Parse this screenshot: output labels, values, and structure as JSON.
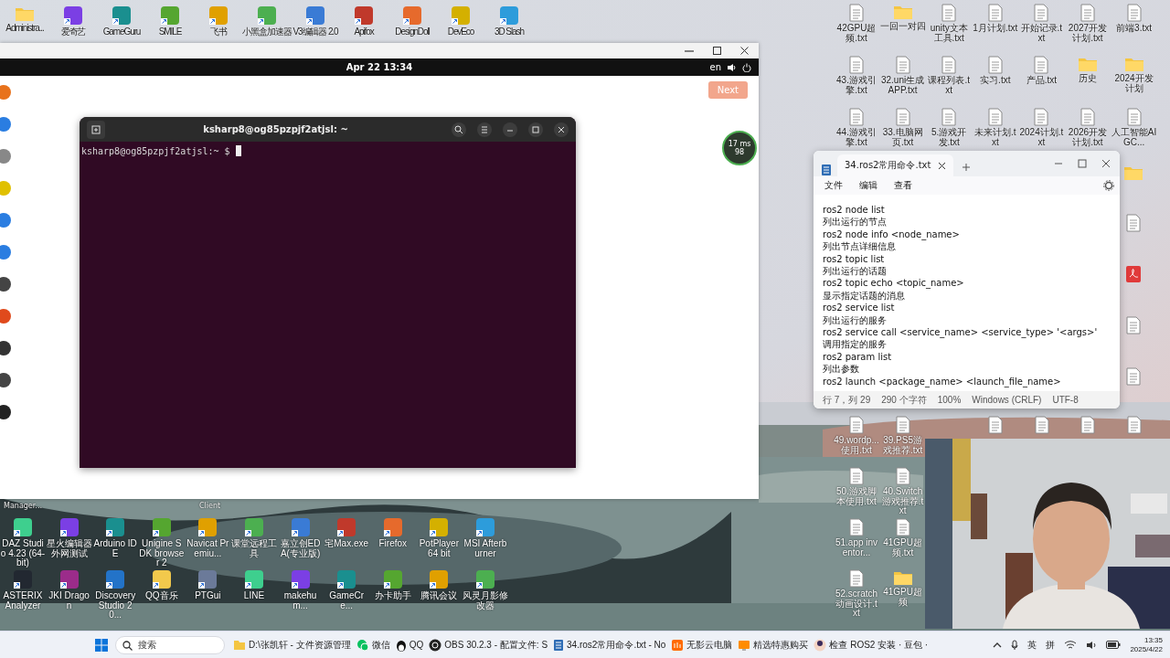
{
  "desktop_top_icons": [
    {
      "label": "Administra...",
      "kind": "folder"
    },
    {
      "label": "爱奇艺",
      "kind": "app"
    },
    {
      "label": "GameGuru",
      "kind": "app"
    },
    {
      "label": "SMILE",
      "kind": "app"
    },
    {
      "label": "飞书",
      "kind": "app"
    },
    {
      "label": "小黑盒加速器",
      "kind": "app"
    },
    {
      "label": "V3编辑器 2.0",
      "kind": "app"
    },
    {
      "label": "Apifox",
      "kind": "app"
    },
    {
      "label": "DesignDoll",
      "kind": "app"
    },
    {
      "label": "DevEco",
      "kind": "app"
    },
    {
      "label": "3D Slash",
      "kind": "app"
    }
  ],
  "remote_window": {
    "topbar": {
      "clock": "Apr 22 13:34",
      "language": "en"
    },
    "page": {
      "next_button": "Next",
      "ping_latency": "17 ms",
      "ping_value": "98"
    },
    "terminal": {
      "title": "ksharp8@og85pzpjf2atjsl: ~",
      "prompt_user": "ksharp8@og85pzpjf2atjsl",
      "prompt_path": ":~",
      "prompt_symbol": "$"
    }
  },
  "desktop_captions": [
    "Manager...",
    "Client"
  ],
  "desktop_bottom_icons": [
    {
      "label": "DAZ Studio 4.23 (64-bit)",
      "kind": "app"
    },
    {
      "label": "星火编辑器外网测试",
      "kind": "app"
    },
    {
      "label": "Arduino IDE",
      "kind": "app"
    },
    {
      "label": "Unigine SDK browser 2",
      "kind": "app"
    },
    {
      "label": "Navicat Premiu...",
      "kind": "app"
    },
    {
      "label": "课堂远程工具",
      "kind": "app"
    },
    {
      "label": "嘉立创EDA(专业版)",
      "kind": "app"
    },
    {
      "label": "宅Max.exe",
      "kind": "app"
    },
    {
      "label": "Firefox",
      "kind": "app"
    },
    {
      "label": "PotPlayer 64 bit",
      "kind": "app"
    },
    {
      "label": "MSI Afterburner",
      "kind": "app"
    },
    {
      "label": "ASTERIX Analyzer",
      "kind": "app"
    },
    {
      "label": "JKI Dragon",
      "kind": "app"
    },
    {
      "label": "Discovery Studio 20...",
      "kind": "app"
    },
    {
      "label": "QQ音乐",
      "kind": "app"
    },
    {
      "label": "PTGui",
      "kind": "app"
    },
    {
      "label": "LINE",
      "kind": "app"
    },
    {
      "label": "makehum...",
      "kind": "app"
    },
    {
      "label": "GameCre...",
      "kind": "app"
    },
    {
      "label": "办卡助手",
      "kind": "app"
    },
    {
      "label": "腾讯会议",
      "kind": "app"
    },
    {
      "label": "风灵月影修改器",
      "kind": "app"
    }
  ],
  "desktop_right_icons": [
    {
      "label": "42GPU超频.txt",
      "kind": "file"
    },
    {
      "label": "一回一对四",
      "kind": "folder"
    },
    {
      "label": "unity文本工具.txt",
      "kind": "file"
    },
    {
      "label": "1月计划.txt",
      "kind": "file"
    },
    {
      "label": "开始记录.txt",
      "kind": "file"
    },
    {
      "label": "2027开发计划.txt",
      "kind": "file"
    },
    {
      "label": "前端3.txt",
      "kind": "file"
    },
    {
      "label": "43.游戏引擎.txt",
      "kind": "file"
    },
    {
      "label": "32.uni生成APP.txt",
      "kind": "file"
    },
    {
      "label": "课程列表.txt",
      "kind": "file"
    },
    {
      "label": "实习.txt",
      "kind": "file"
    },
    {
      "label": "产品.txt",
      "kind": "file"
    },
    {
      "label": "历史",
      "kind": "folder"
    },
    {
      "label": "2024开发计划",
      "kind": "folder"
    },
    {
      "label": "44.游戏引擎.txt",
      "kind": "file"
    },
    {
      "label": "33.电脑网页.txt",
      "kind": "file"
    },
    {
      "label": "5.游戏开发.txt",
      "kind": "file"
    },
    {
      "label": "未来计划.txt",
      "kind": "file"
    },
    {
      "label": "2024计划.txt",
      "kind": "file"
    },
    {
      "label": "2026开发计划.txt",
      "kind": "file"
    },
    {
      "label": "人工智能AIGC...",
      "kind": "file"
    }
  ],
  "desktop_side_icons": [
    {
      "kind": "folder"
    },
    {
      "kind": "file"
    },
    {
      "kind": "pdf"
    },
    {
      "kind": "file"
    },
    {
      "kind": "file"
    }
  ],
  "notepad": {
    "tab": "34.ros2常用命令.txt",
    "menu": [
      "文件",
      "编辑",
      "查看"
    ],
    "lines": [
      "ros2 node list",
      "列出运行的节点",
      "ros2 node info <node_name>",
      "列出节点详细信息",
      "ros2 topic list",
      "列出运行的话题",
      "ros2 topic echo <topic_name>",
      "显示指定话题的消息",
      "ros2 service list",
      "列出运行的服务",
      "ros2 service call <service_name> <service_type> '<args>'",
      "调用指定的服务",
      "ros2 param list",
      "列出参数",
      "ros2 launch <package_name> <launch_file_name>"
    ],
    "status": [
      "行 7，列 29",
      "290 个字符",
      "100%",
      "Windows (CRLF)",
      "UTF-8"
    ]
  },
  "desktop_lower_icons": [
    {
      "label": "49.wordp... 使用.txt",
      "kind": "file"
    },
    {
      "label": "39.PS5游戏推荐.txt",
      "kind": "file"
    },
    {
      "label": "50.游戏脚本使用.txt",
      "kind": "file"
    },
    {
      "label": "40.Switch游戏推荐.txt",
      "kind": "file"
    },
    {
      "label": "51.app inventor...",
      "kind": "file"
    },
    {
      "label": "41GPU超频.txt",
      "kind": "file"
    },
    {
      "label": "52.scratch动画设计.txt",
      "kind": "file"
    },
    {
      "label": "41GPU超频",
      "kind": "folder"
    }
  ],
  "desktop_covered_icons": [
    {
      "kind": "file"
    },
    {
      "kind": "file"
    },
    {
      "kind": "file"
    },
    {
      "kind": "file"
    }
  ],
  "webcam": {
    "kind": "picture"
  },
  "taskbar": {
    "search_placeholder": "搜索",
    "apps": [
      {
        "label": "D:\\张凯轩 - 文件资源管理",
        "kind": "folder"
      },
      {
        "label": "微信",
        "kind": "chat"
      },
      {
        "label": "QQ",
        "kind": "penguin"
      },
      {
        "label": "OBS 30.2.3 - 配置文件: S",
        "kind": "record"
      },
      {
        "label": "34.ros2常用命令.txt - No",
        "kind": "notepad"
      },
      {
        "label": "无影云电脑",
        "kind": "cloud"
      },
      {
        "label": "精选特惠购买",
        "kind": "shop"
      },
      {
        "label": "检查 ROS2 安装 · 豆包 ·",
        "kind": "assistant"
      }
    ],
    "ime": [
      "英",
      "拼"
    ],
    "time": "13:35",
    "date": "2025/4/22"
  }
}
